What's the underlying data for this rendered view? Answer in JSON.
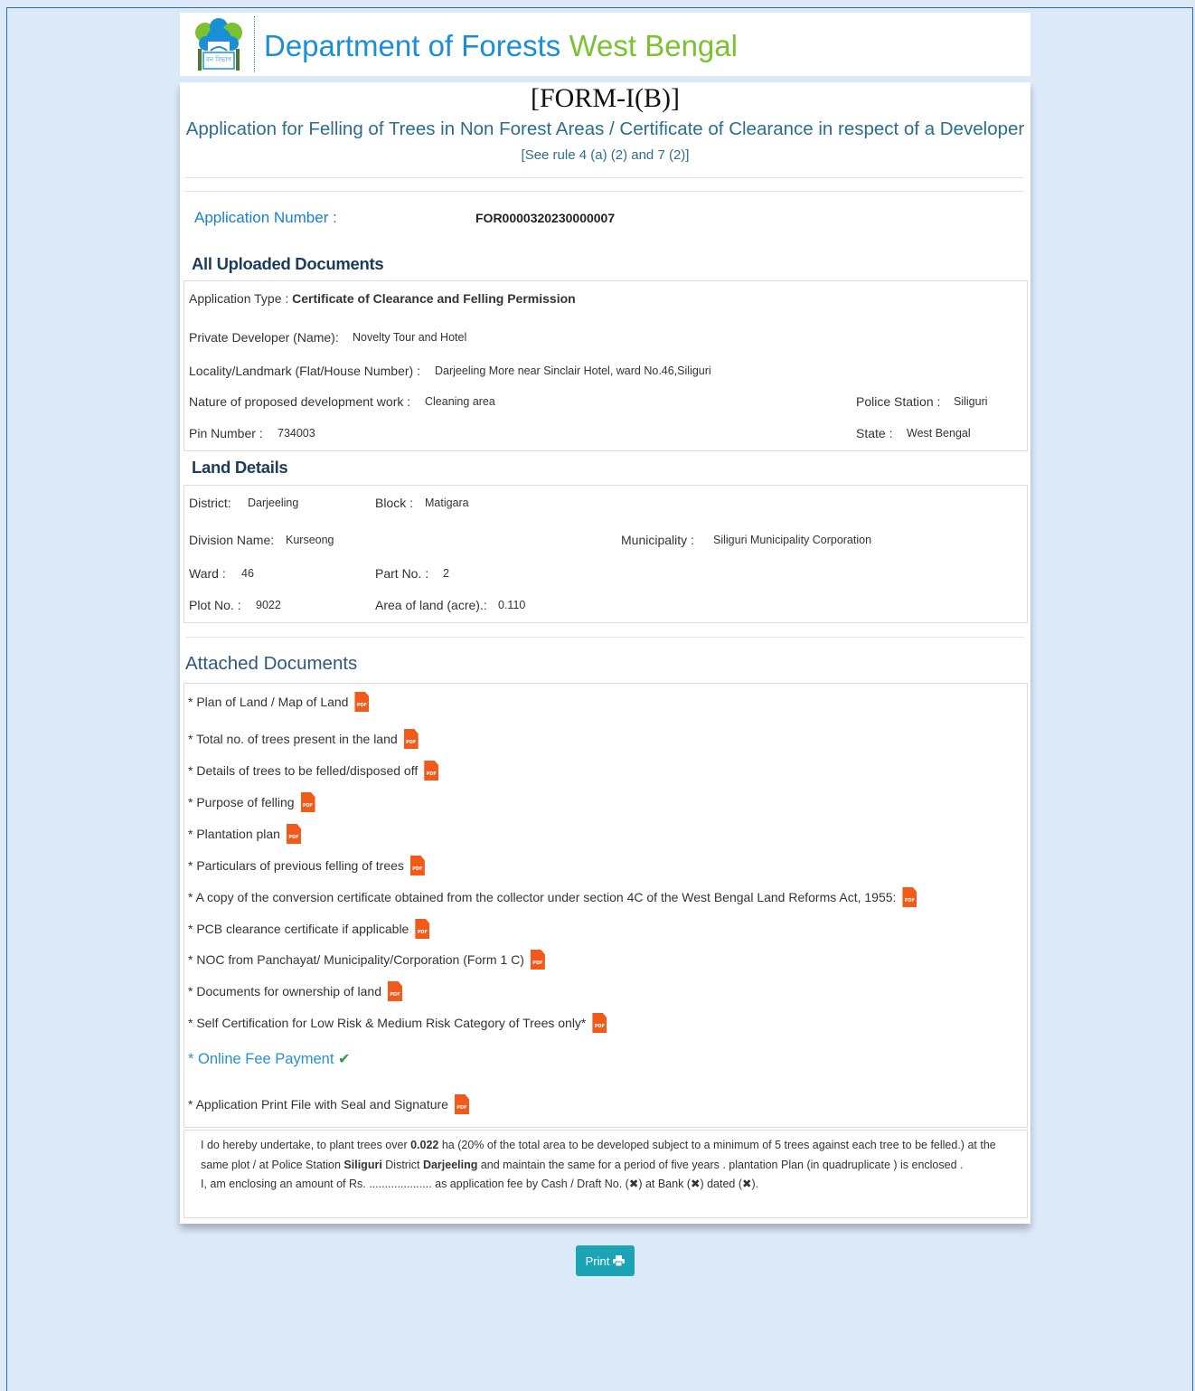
{
  "header": {
    "title_main": "Department of Forests",
    "title_accent": "West Bengal",
    "logo_text": "বন বিভাগ"
  },
  "form": {
    "title": "[FORM-I(B)]",
    "subtitle": "Application for Felling of Trees in Non Forest Areas / Certificate of Clearance in respect of a Developer",
    "rule": "[See rule 4 (a) (2) and 7 (2)]"
  },
  "application": {
    "number_label": "Application Number :",
    "number_value": "FOR0000320230000007"
  },
  "uploaded": {
    "heading": "All Uploaded Documents",
    "app_type_label": "Application Type :",
    "app_type_value": "Certificate of Clearance and Felling Permission",
    "developer_label": "Private Developer (Name):",
    "developer_value": "Novelty Tour and Hotel",
    "locality_label": "Locality/Landmark (Flat/House Number) :",
    "locality_value": "Darjeeling More near Sinclair Hotel, ward No.46,Siliguri",
    "nature_label": "Nature of proposed development work :",
    "nature_value": "Cleaning area",
    "police_label": "Police Station :",
    "police_value": "Siliguri",
    "pin_label": "Pin Number :",
    "pin_value": "734003",
    "state_label": "State :",
    "state_value": "West Bengal"
  },
  "land": {
    "heading": "Land Details",
    "district_label": "District:",
    "district_value": "Darjeeling",
    "block_label": "Block :",
    "block_value": "Matigara",
    "division_label": "Division Name:",
    "division_value": "Kurseong",
    "municipality_label": "Municipality :",
    "municipality_value": "Siliguri Municipality Corporation",
    "ward_label": "Ward :",
    "ward_value": "46",
    "part_label": "Part No. :",
    "part_value": "2",
    "plot_label": "Plot No. :",
    "plot_value": "9022",
    "area_label": "Area of land (acre).:",
    "area_value": "0.110"
  },
  "attached": {
    "heading": "Attached Documents",
    "pdf_icon_text": "PDF",
    "docs": [
      "* Plan of Land / Map of Land",
      "* Total no. of trees present in the land",
      "* Details of trees to be felled/disposed off",
      "* Purpose of felling",
      "* Plantation plan",
      "* Particulars of previous felling of trees",
      "* A copy of the conversion certificate obtained from the collector under section 4C of the West Bengal Land Reforms Act, 1955:",
      "* PCB clearance certificate if applicable",
      "* NOC from Panchayat/ Municipality/Corporation (Form 1 C)",
      "* Documents for ownership of land",
      "* Self Certification for Low Risk & Medium Risk Category of Trees only*"
    ],
    "fee_label": "* Online Fee Payment",
    "print_file_label": "* Application Print File with Seal and Signature"
  },
  "undertaking": {
    "p1_a": "I do hereby undertake, to plant trees over ",
    "p1_area": "0.022",
    "p1_b": " ha (20% of the total area to be developed subject to a minimum of 5 trees against each tree to be felled.) at the same plot / at Police Station ",
    "p1_ps": "Siliguri",
    "p1_c": " District ",
    "p1_district": "Darjeeling",
    "p1_d": " and maintain the same for a period of five years . plantation Plan (in quadruplicate ) is enclosed .",
    "p2_a": "I, am enclosing an amount of Rs. .................... as application fee by Cash / Draft No. (",
    "p2_b": ") at Bank (",
    "p2_c": ") dated (",
    "p2_d": ").",
    "x_symbol": "✖"
  },
  "print_button": "Print"
}
